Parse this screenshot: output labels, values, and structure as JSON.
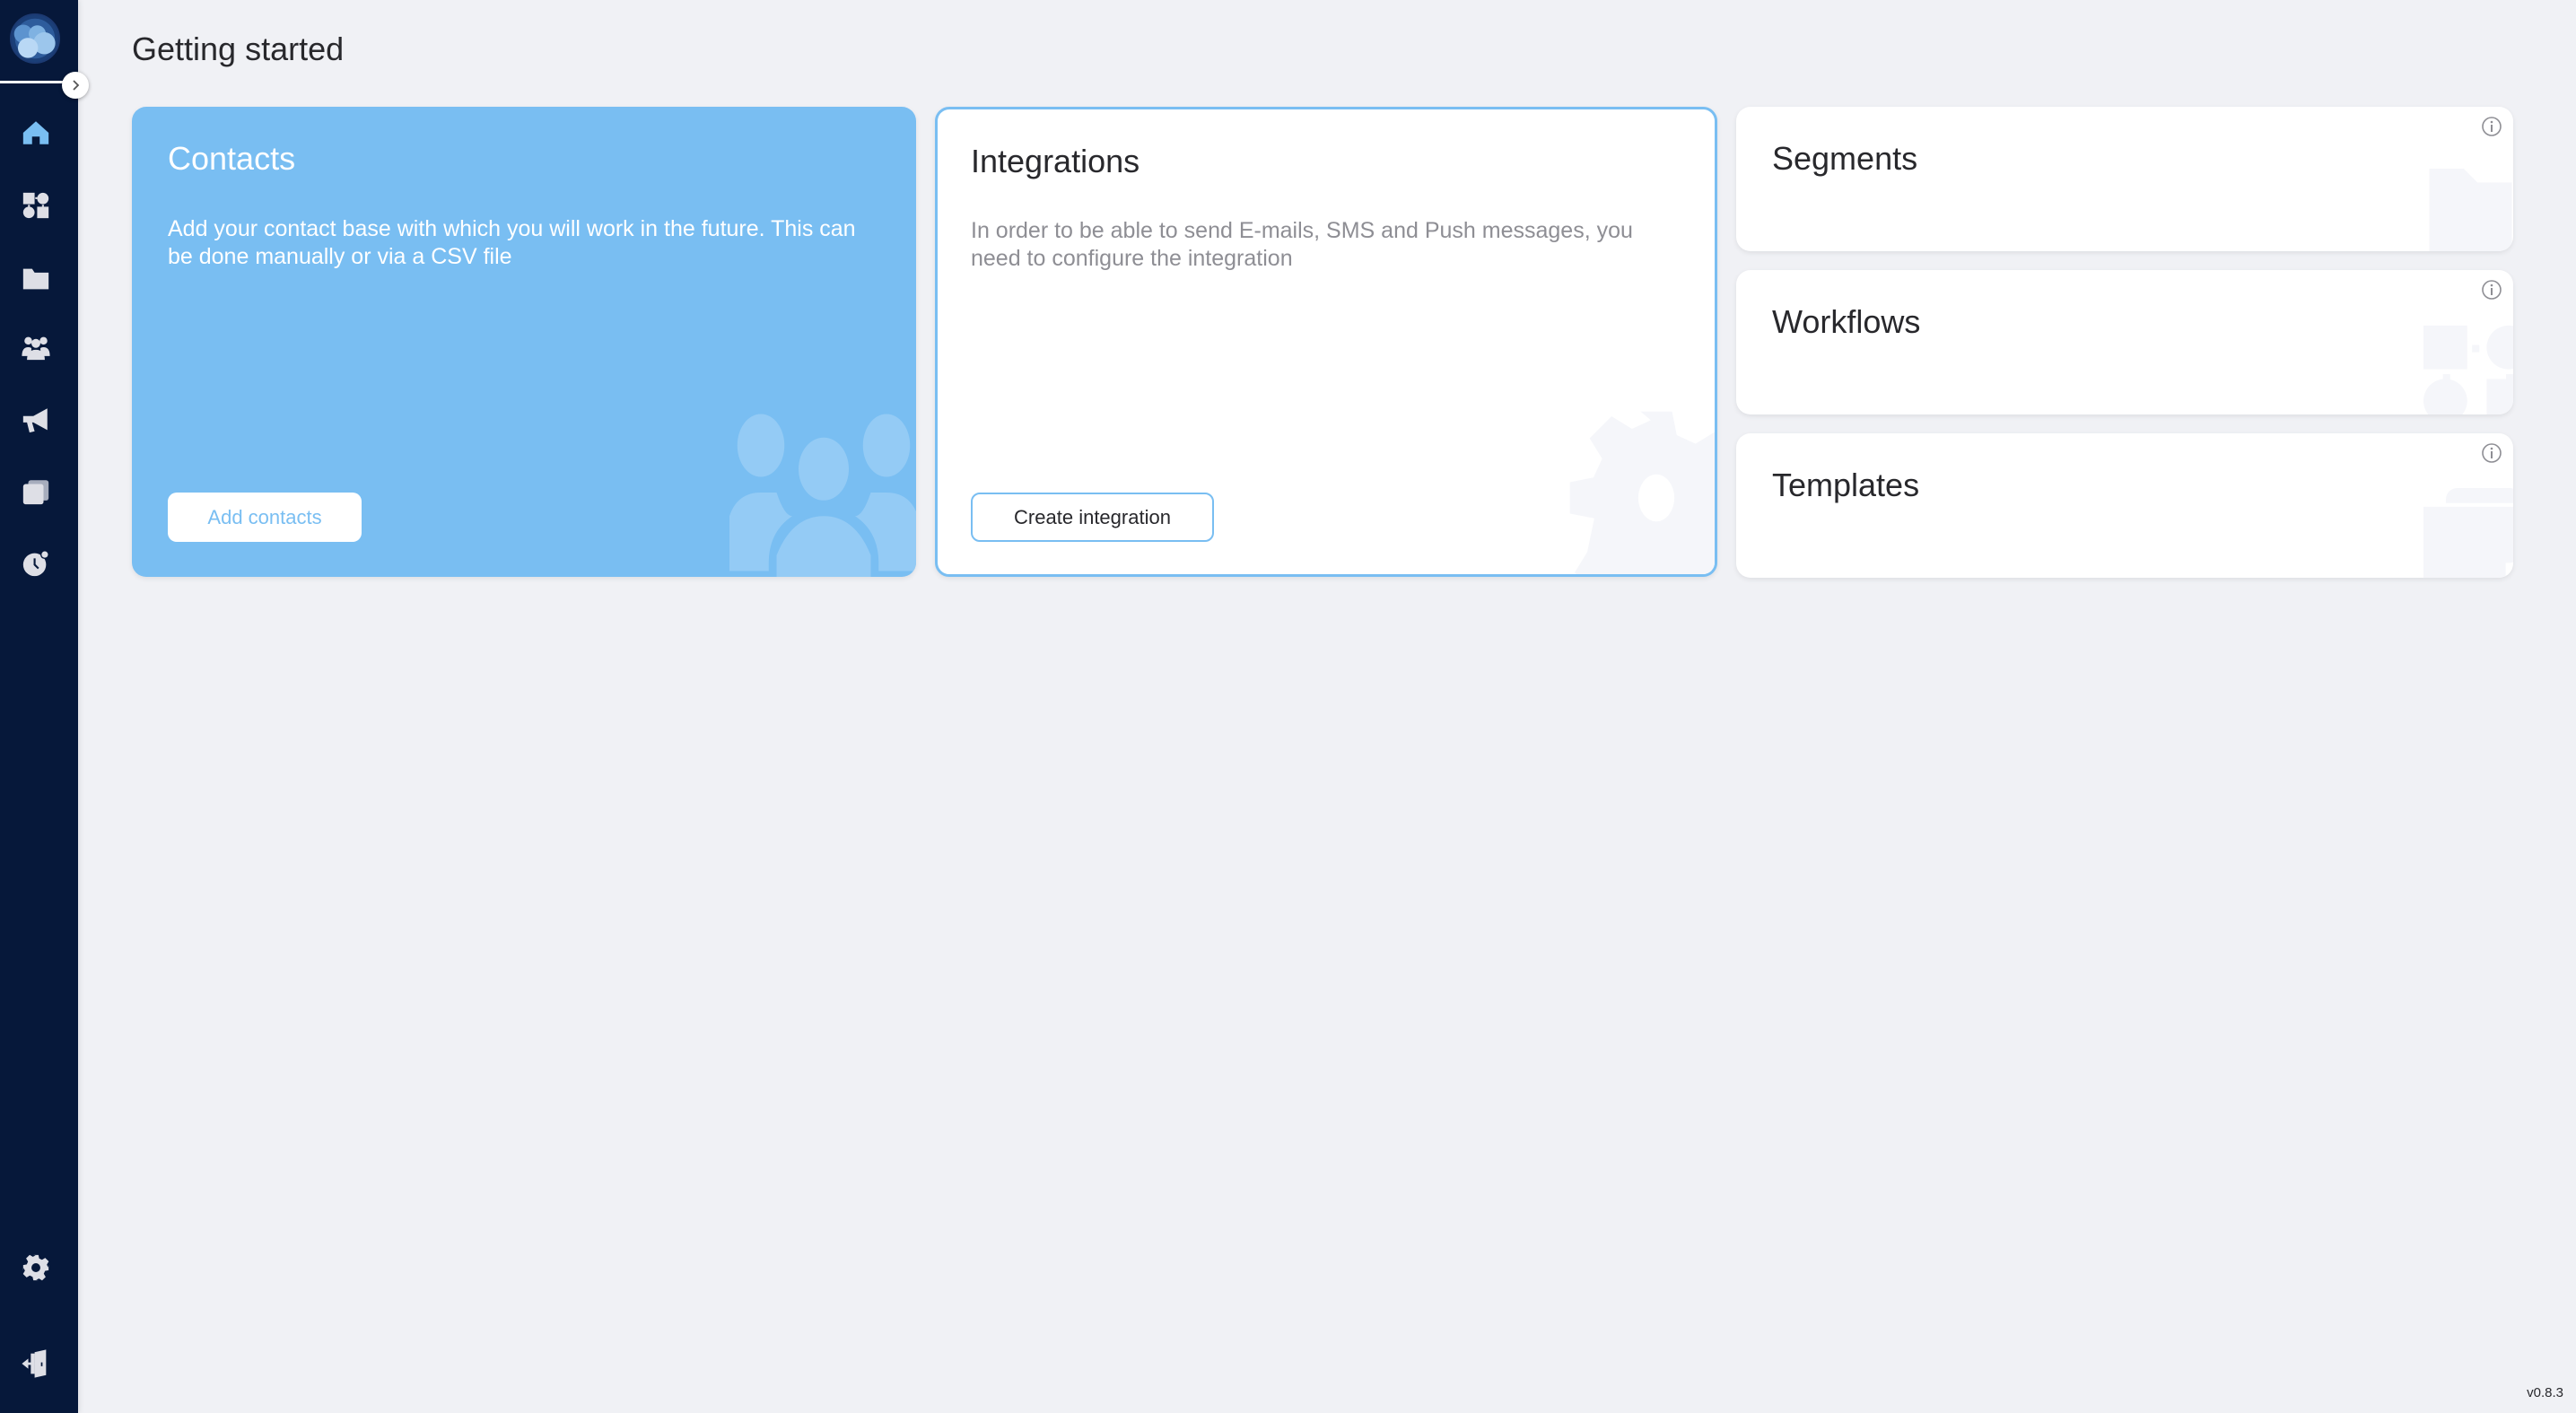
{
  "sidebar": {
    "logo": "app-logo",
    "toggle_icon": "chevron-right-icon",
    "items": [
      {
        "name": "home",
        "icon": "home-icon",
        "active": true
      },
      {
        "name": "workflows",
        "icon": "workflow-icon",
        "active": false
      },
      {
        "name": "segments",
        "icon": "folder-icon",
        "active": false
      },
      {
        "name": "contacts",
        "icon": "people-icon",
        "active": false
      },
      {
        "name": "campaigns",
        "icon": "megaphone-icon",
        "active": false
      },
      {
        "name": "templates",
        "icon": "templates-icon",
        "active": false
      },
      {
        "name": "history",
        "icon": "clock-icon",
        "active": false
      }
    ],
    "bottom_items": [
      {
        "name": "settings",
        "icon": "gear-icon"
      },
      {
        "name": "logout",
        "icon": "logout-icon"
      }
    ],
    "colors": {
      "background": "#06183a",
      "active_icon": "#79bef2",
      "icon": "#dedfe6"
    }
  },
  "main": {
    "title": "Getting started",
    "cards": {
      "contacts": {
        "title": "Contacts",
        "description": "Add your contact base with which you will work in the future. This can be done manually or via a CSV file",
        "button": "Add contacts",
        "watermark_icon": "people-icon"
      },
      "integrations": {
        "title": "Integrations",
        "description": "In order to be able to send E-mails, SMS and Push messages, you need to configure the integration",
        "button": "Create integration",
        "watermark_icon": "gear-icon"
      },
      "segments": {
        "title": "Segments",
        "info_icon": "info-icon",
        "watermark_icon": "folder-icon"
      },
      "workflows": {
        "title": "Workflows",
        "info_icon": "info-icon",
        "watermark_icon": "workflow-icon"
      },
      "templates": {
        "title": "Templates",
        "info_icon": "info-icon",
        "watermark_icon": "templates-icon"
      }
    },
    "colors": {
      "accent": "#79bef2",
      "background": "#f0f1f5",
      "muted_text": "#8e8e94"
    }
  },
  "footer": {
    "version": "v0.8.3"
  }
}
